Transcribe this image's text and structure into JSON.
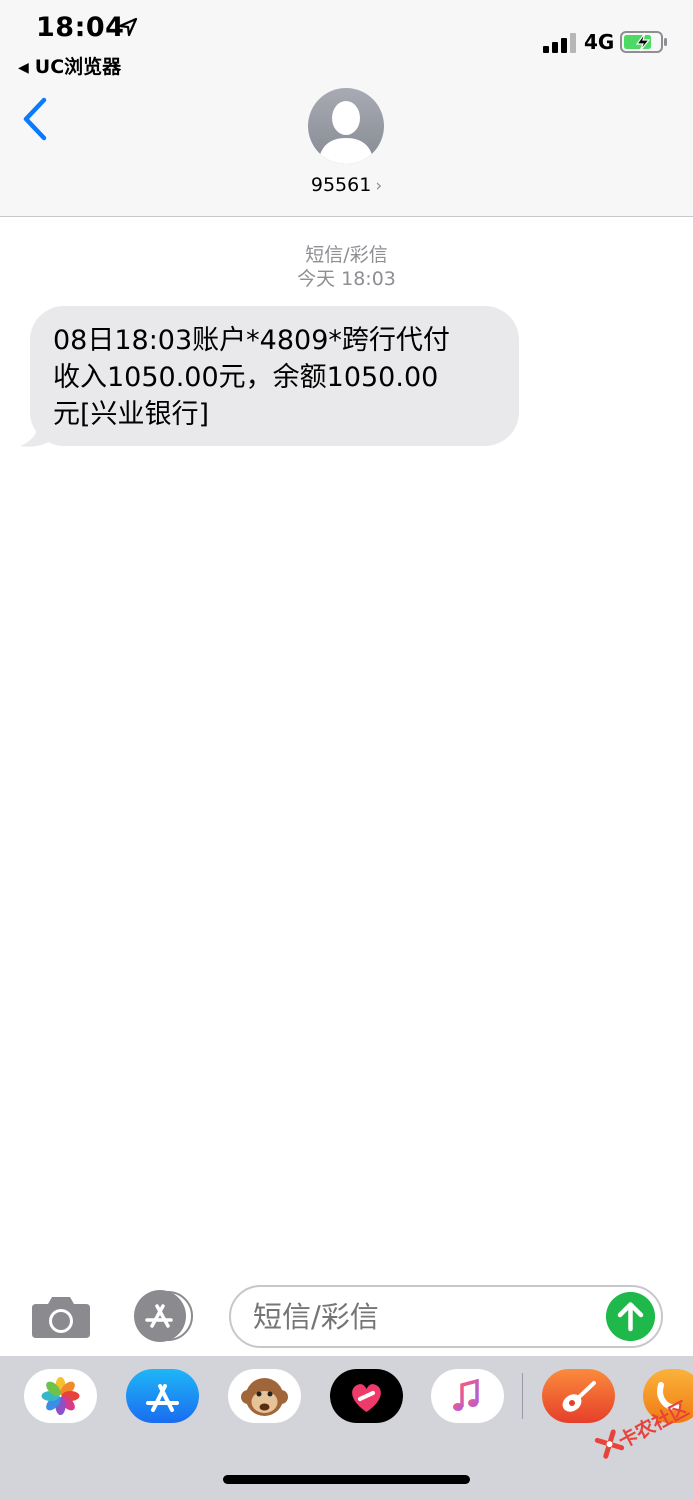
{
  "status_bar": {
    "time": "18:04",
    "back_app": "UC浏览器",
    "network": "4G"
  },
  "header": {
    "contact": "95561",
    "contact_chevron": "›"
  },
  "thread": {
    "service": "短信/彩信",
    "timestamp": "今天 18:03",
    "messages": [
      {
        "direction": "incoming",
        "lines": [
          "08日18:03账户*4809*跨行代付",
          "收入1050.00元，余额1050.00",
          "元[兴业银行]"
        ]
      }
    ]
  },
  "composer": {
    "placeholder": "短信/彩信"
  },
  "app_drawer": {
    "apps": [
      "photos",
      "app-store",
      "animoji",
      "digital-touch",
      "music",
      "garageband",
      "uc-browser"
    ]
  },
  "watermark": {
    "text": "卡农社区"
  },
  "colors": {
    "ios_blue": "#0a7aff",
    "send_green": "#1fb84a",
    "bubble_gray": "#e9e9eb",
    "secondary_text": "#8e8e93"
  }
}
